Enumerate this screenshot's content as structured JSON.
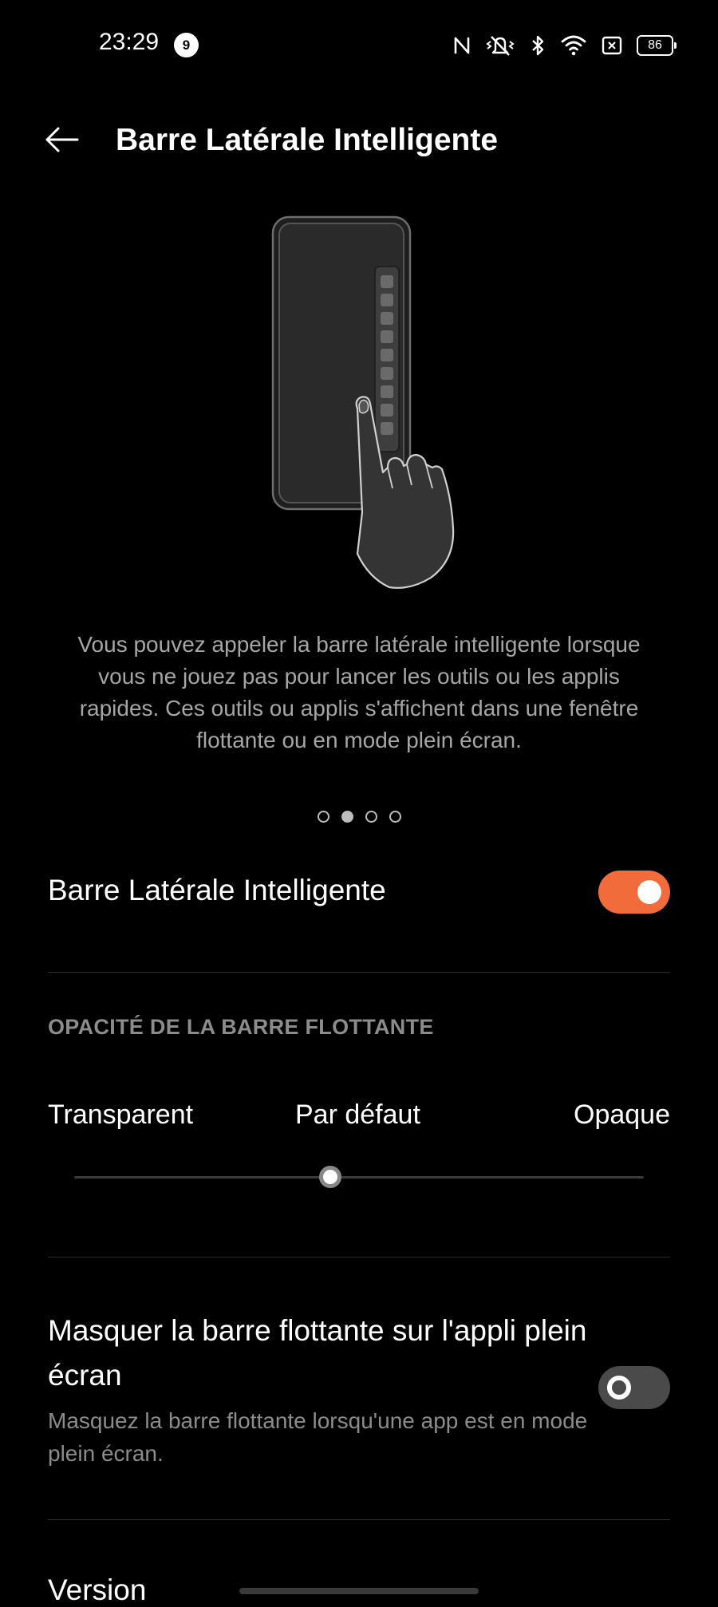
{
  "status_bar": {
    "time": "23:29",
    "notification_count": "9",
    "battery": "86",
    "icons": [
      "nfc-icon",
      "vibrate-mute-icon",
      "bluetooth-icon",
      "wifi-icon",
      "sim-none-icon",
      "battery-icon"
    ]
  },
  "header": {
    "back_icon": "arrow-left-icon",
    "title": "Barre Latérale Intelligente"
  },
  "illustration": {
    "icon": "phone-sidebar-hand-illustration"
  },
  "description": "Vous pouvez appeler la barre latérale intelligente lorsque vous ne jouez pas pour lancer les outils ou les applis rapides. Ces outils ou applis s'affichent dans une fenêtre flottante ou en mode plein écran.",
  "pager": {
    "count": 4,
    "active_index": 1
  },
  "smart_sidebar": {
    "label": "Barre Latérale Intelligente",
    "enabled": true
  },
  "opacity": {
    "section_title": "OPACITÉ DE LA BARRE FLOTTANTE",
    "labels": [
      "Transparent",
      "Par défaut",
      "Opaque"
    ],
    "value_percent": 45
  },
  "hide_on_fullscreen": {
    "title": "Masquer la barre flottante sur l'appli plein écran",
    "subtitle": "Masquez la barre flottante lorsqu'une app est en mode plein écran.",
    "enabled": false
  },
  "version": {
    "label": "Version"
  },
  "colors": {
    "accent": "#f26b3a",
    "background": "#000000",
    "secondary_text": "#a6a6a6"
  }
}
